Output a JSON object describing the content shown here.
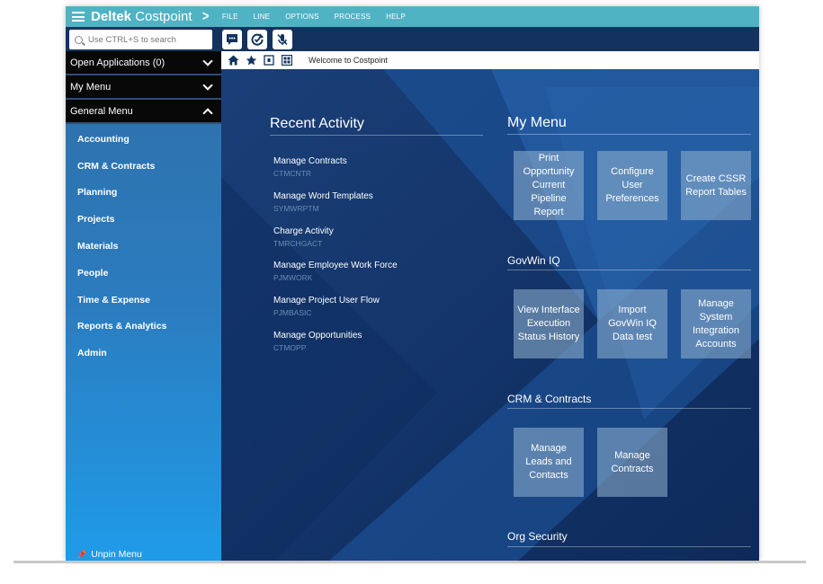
{
  "app": {
    "brand_bold": "Deltek",
    "brand_light": " Costpoint",
    "menus": [
      "FILE",
      "LINE",
      "OPTIONS",
      "PROCESS",
      "HELP"
    ]
  },
  "toolbar": {
    "search_placeholder": "Use CTRL+S to search",
    "buttons": [
      "chat-icon",
      "refresh-check-icon",
      "mute-microphone-icon"
    ]
  },
  "sidebar": {
    "open_applications": "Open Applications (0)",
    "my_menu": "My Menu",
    "general_menu": "General Menu",
    "items": [
      "Accounting",
      "CRM & Contracts",
      "Planning",
      "Projects",
      "Materials",
      "People",
      "Time & Expense",
      "Reports & Analytics",
      "Admin"
    ],
    "unpin": "Unpin Menu"
  },
  "breadcrumb": {
    "icons": [
      "home-icon",
      "star-icon",
      "square-icon",
      "grid-icon"
    ],
    "text": "Welcome to Costpoint"
  },
  "recent_activity": {
    "title": "Recent Activity",
    "items": [
      {
        "name": "Manage Contracts",
        "code": "CTMCNTR"
      },
      {
        "name": "Manage Word Templates",
        "code": "SYMWRPTM"
      },
      {
        "name": "Charge Activity",
        "code": "TMRCHGACT"
      },
      {
        "name": "Manage Employee Work Force",
        "code": "PJMWORK"
      },
      {
        "name": "Manage Project User Flow",
        "code": "PJMBASIC"
      },
      {
        "name": "Manage Opportunities",
        "code": "CTMOPP"
      }
    ]
  },
  "my_menu": {
    "title": "My Menu",
    "tiles": [
      "Print Opportunity Current Pipeline Report",
      "Configure User Preferences",
      "Create CSSR Report Tables"
    ]
  },
  "govwin": {
    "title": "GovWin IQ",
    "tiles": [
      "View Interface Execution Status History",
      "Import GovWin IQ Data test",
      "Manage System Integration Accounts"
    ]
  },
  "crm": {
    "title": "CRM & Contracts",
    "tiles": [
      "Manage Leads and Contacts",
      "Manage Contracts"
    ]
  },
  "org_security": {
    "title": "Org Security"
  },
  "colors": {
    "topbar": "#4fb3c4",
    "toolbar": "#13335e",
    "main_bg": "#1f4e8c"
  }
}
